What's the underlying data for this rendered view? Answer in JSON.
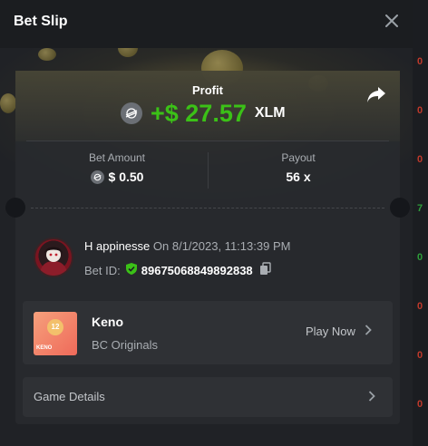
{
  "modal": {
    "title": "Bet Slip"
  },
  "profit": {
    "label": "Profit",
    "value": "+$ 27.57",
    "currency": "XLM"
  },
  "stats": {
    "bet_amount_label": "Bet Amount",
    "bet_amount_value": "$ 0.50",
    "payout_label": "Payout",
    "payout_value": "56 x"
  },
  "bet": {
    "username": "H appinesse",
    "on_text": "On 8/1/2023, 11:13:39 PM",
    "bet_id_label": "Bet ID:",
    "bet_id": "89675068849892838"
  },
  "game": {
    "name": "Keno",
    "provider": "BC Originals",
    "play_label": "Play Now",
    "thumb_number": "12",
    "thumb_tag": "KENO"
  },
  "details": {
    "label": "Game Details"
  },
  "colors": {
    "profit_green": "#3bc117",
    "panel": "#2f3135",
    "background": "#1e2024"
  },
  "icons": {
    "close": "close-icon",
    "share": "share-icon",
    "currency": "stellar-xlm-icon",
    "verified": "shield-check-icon",
    "copy": "copy-icon",
    "chevron": "chevron-right-icon"
  },
  "background_strip": [
    "0",
    "0",
    "0",
    "7",
    "0",
    "0",
    "0",
    "0",
    "0"
  ]
}
